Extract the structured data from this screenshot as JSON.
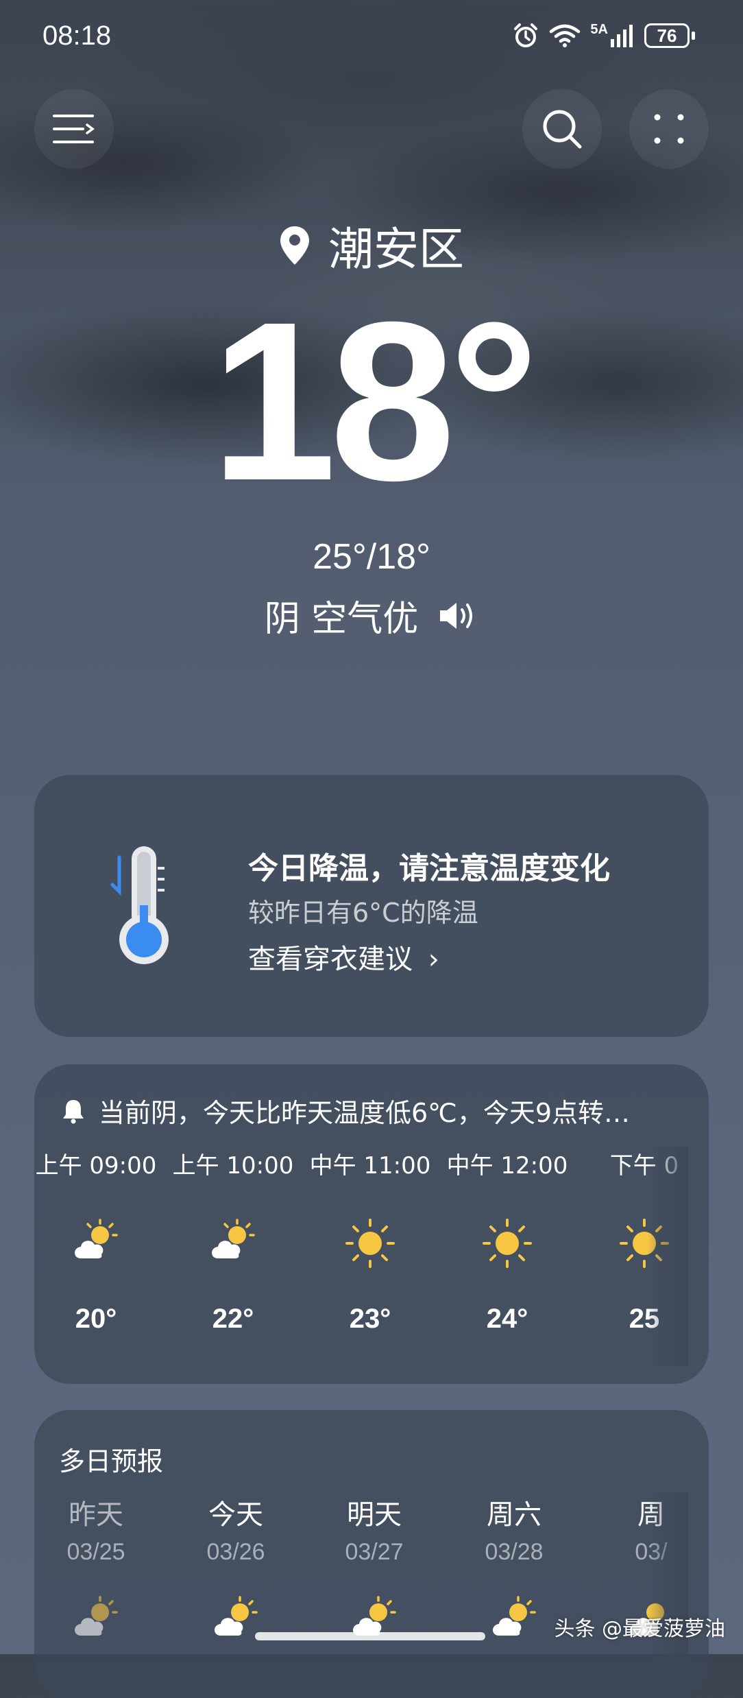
{
  "status_bar": {
    "time": "08:18",
    "network": "5A",
    "battery": "76"
  },
  "header": {
    "location": "潮安区",
    "temperature": "18°",
    "range": "25°/18°",
    "condition": "阴 空气优"
  },
  "tip_card": {
    "title": "今日降温，请注意温度变化",
    "subtitle": "较昨日有6°C的降温",
    "link": "查看穿衣建议",
    "link_arrow": "›"
  },
  "hourly": {
    "alert": "当前阴，今天比昨天温度低6℃，今天9点转…",
    "items": [
      {
        "label": "上午 09:00",
        "icon": "partly-cloudy-icon",
        "temp": "20°"
      },
      {
        "label": "上午 10:00",
        "icon": "partly-cloudy-icon",
        "temp": "22°"
      },
      {
        "label": "中午 11:00",
        "icon": "sunny-icon",
        "temp": "23°"
      },
      {
        "label": "中午 12:00",
        "icon": "sunny-icon",
        "temp": "24°"
      },
      {
        "label": "下午 0",
        "icon": "sunny-icon",
        "temp": "25"
      }
    ]
  },
  "daily": {
    "title": "多日预报",
    "items": [
      {
        "name": "昨天",
        "date": "03/25",
        "icon": "partly-cloudy-icon"
      },
      {
        "name": "今天",
        "date": "03/26",
        "icon": "partly-cloudy-icon"
      },
      {
        "name": "明天",
        "date": "03/27",
        "icon": "partly-cloudy-icon"
      },
      {
        "name": "周六",
        "date": "03/28",
        "icon": "partly-cloudy-icon"
      },
      {
        "name": "周",
        "date": "03/",
        "icon": "partly-cloudy-icon"
      }
    ]
  },
  "watermark": "头条 @最爱菠萝油",
  "colors": {
    "sun": "#f7c744",
    "card": "#3c4656",
    "thermo_blue": "#3b8cf0"
  }
}
